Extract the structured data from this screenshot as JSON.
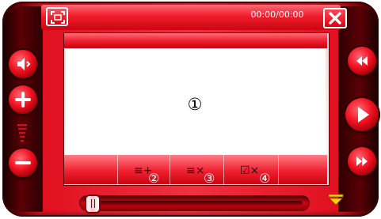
{
  "window": {
    "time_display": "00:00/00:00"
  },
  "playlist": {
    "content_marker": "①",
    "buttons": [
      {
        "id": "add",
        "icon": "list-add-icon",
        "glyph": "≡+",
        "number": "②"
      },
      {
        "id": "remove",
        "icon": "list-remove-icon",
        "glyph": "≡×",
        "number": "③"
      },
      {
        "id": "remove-checked",
        "icon": "checked-remove-icon",
        "glyph": "☑×",
        "number": "④"
      }
    ]
  },
  "controls": {
    "left": [
      "mute-icon",
      "volume-up-icon",
      "volume-down-icon"
    ],
    "right": [
      "rewind-icon",
      "play-icon",
      "fast-forward-icon"
    ]
  },
  "seek": {
    "position": 0
  },
  "colors": {
    "accent": "#f01c2a",
    "dark": "#3a0004",
    "panel": "#ffffff"
  }
}
